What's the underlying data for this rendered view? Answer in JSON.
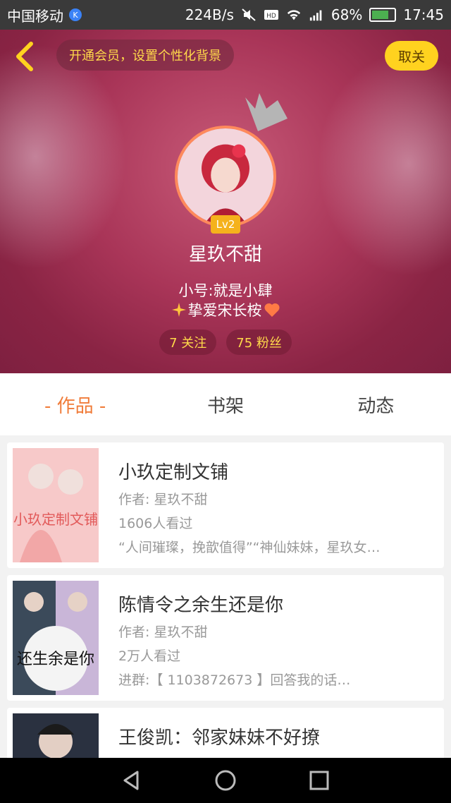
{
  "status_bar": {
    "carrier": "中国移动",
    "speed": "224B/s",
    "battery": "68%",
    "time": "17:45"
  },
  "header": {
    "vip_prompt": "开通会员，设置个性化背景",
    "unfollow_label": "取关",
    "level": "Lv2",
    "nickname": "星玖不甜",
    "bio_line1": "小号:就是小肆",
    "bio_line2": "挚爱宋长桉",
    "following": "7 关注",
    "followers": "75 粉丝"
  },
  "tabs": [
    {
      "label": "- 作品 -",
      "active": true
    },
    {
      "label": "书架",
      "active": false
    },
    {
      "label": "动态",
      "active": false
    }
  ],
  "works": [
    {
      "title": "小玖定制文铺",
      "author": "作者: 星玖不甜",
      "views": "1606人看过",
      "desc": "“人间璀璨，挽歆值得”“神仙妹妹，星玖女…",
      "cover_text": "小玖定制文铺"
    },
    {
      "title": "陈情令之余生还是你",
      "author": "作者: 星玖不甜",
      "views": "2万人看过",
      "desc": "进群:【 1103872673 】回答我的话…",
      "cover_text": "还生余是你"
    },
    {
      "title": "王俊凯：邻家妹妹不好撩",
      "author": "",
      "views": "",
      "desc": ""
    }
  ],
  "colors": {
    "accent": "#f07c3a",
    "gold": "#ffd94a",
    "header_bg": "#a93558"
  }
}
